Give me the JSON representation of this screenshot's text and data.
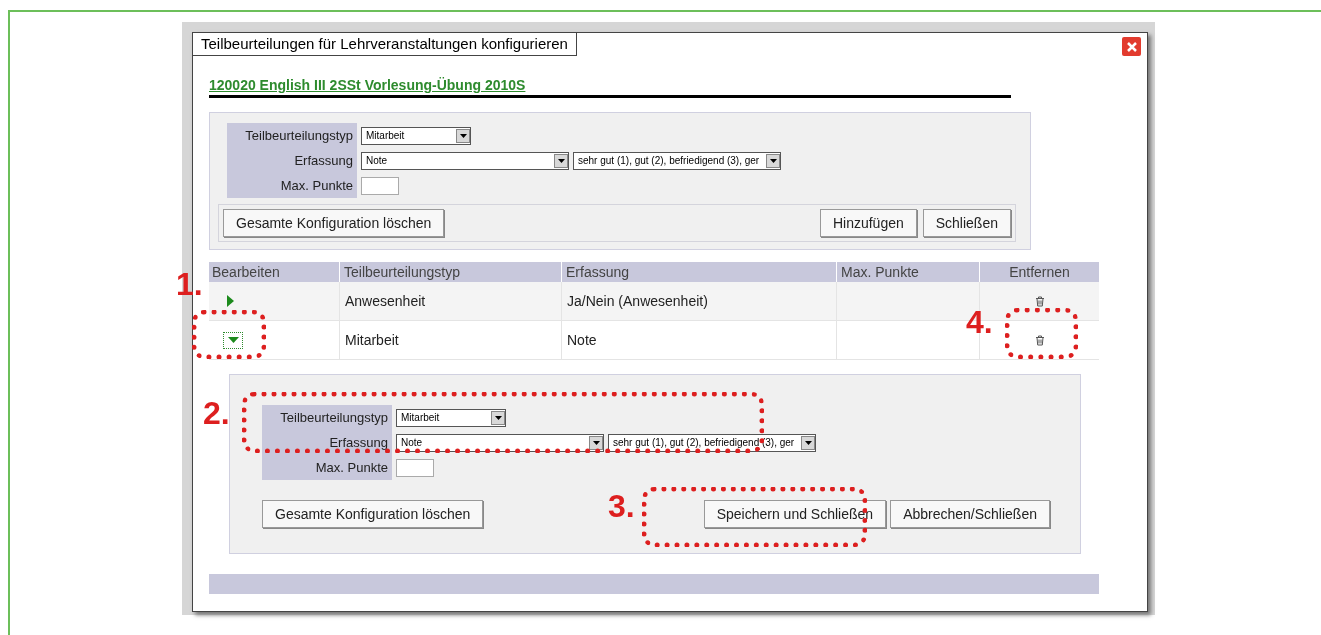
{
  "dialog": {
    "title": "Teilbeurteilungen für Lehrveranstaltungen konfigurieren",
    "course_link": "120020 English III 2SSt Vorlesung-Übung 2010S"
  },
  "top_form": {
    "fields": [
      {
        "label": "Teilbeurteilungstyp",
        "controls": [
          {
            "kind": "select",
            "value": "Mitarbeit"
          }
        ]
      },
      {
        "label": "Erfassung",
        "controls": [
          {
            "kind": "select",
            "value": "Note"
          },
          {
            "kind": "select",
            "value": "sehr gut (1), gut (2), befriedigend (3), ger"
          }
        ]
      },
      {
        "label": "Max. Punkte",
        "controls": [
          {
            "kind": "input"
          }
        ]
      }
    ],
    "left_buttons": [
      "Gesamte Konfiguration löschen"
    ],
    "right_buttons": [
      "Hinzufügen",
      "Schließen"
    ]
  },
  "table": {
    "columns": [
      "Bearbeiten",
      "Teilbeurteilungstyp",
      "Erfassung",
      "Max. Punkte",
      "Entfernen"
    ],
    "rows": [
      {
        "expanded": false,
        "type": "Anwesenheit",
        "capture": "Ja/Nein (Anwesenheit)"
      },
      {
        "expanded": true,
        "type": "Mitarbeit",
        "capture": "Note"
      }
    ]
  },
  "edit_form": {
    "fields": [
      {
        "label": "Teilbeurteilungstyp",
        "controls": [
          {
            "kind": "select",
            "value": "Mitarbeit"
          }
        ]
      },
      {
        "label": "Erfassung",
        "controls": [
          {
            "kind": "select",
            "value": "Note"
          },
          {
            "kind": "select",
            "value": "sehr gut (1), gut (2), befriedigend (3), ger"
          }
        ]
      },
      {
        "label": "Max. Punkte",
        "controls": [
          {
            "kind": "input"
          }
        ]
      }
    ],
    "left_buttons": [
      "Gesamte Konfiguration löschen"
    ],
    "right_buttons": [
      "Speichern und Schließen",
      "Abbrechen/Schließen"
    ]
  },
  "annotations": [
    {
      "label": "1."
    },
    {
      "label": "2."
    },
    {
      "label": "3."
    },
    {
      "label": "4."
    }
  ]
}
